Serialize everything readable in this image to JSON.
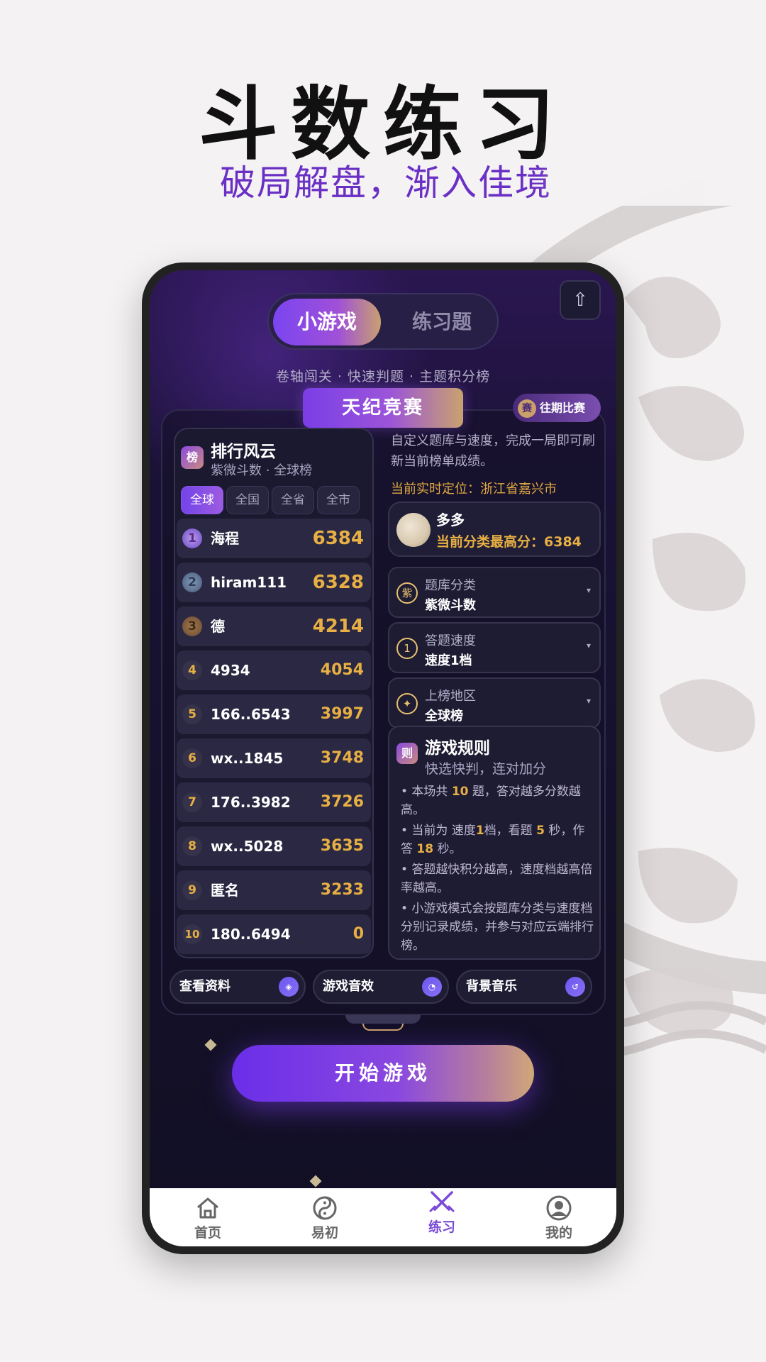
{
  "hero": {
    "title": "斗数练习",
    "subtitle": "破局解盘，渐入佳境"
  },
  "top_tabs": {
    "active": "小游戏",
    "inactive": "练习题"
  },
  "share_icon": "share-icon",
  "features_line": "卷轴闯关 · 快速判题 · 主题积分榜",
  "banner": "天纪竞赛",
  "past_button": {
    "badge": "赛",
    "label": "往期比赛"
  },
  "leaderboard": {
    "icon": "榜",
    "title": "排行风云",
    "subtitle": "紫微斗数 · 全球榜",
    "scopes": [
      "全球",
      "全国",
      "全省",
      "全市"
    ],
    "active_scope": "全球",
    "rows": [
      {
        "rank": "1",
        "name": "海程",
        "score": "6384"
      },
      {
        "rank": "2",
        "name": "hiram111",
        "score": "6328"
      },
      {
        "rank": "3",
        "name": "德",
        "score": "4214"
      },
      {
        "rank": "4",
        "name": "4934",
        "score": "4054"
      },
      {
        "rank": "5",
        "name": "166..6543",
        "score": "3997"
      },
      {
        "rank": "6",
        "name": "wx..1845",
        "score": "3748"
      },
      {
        "rank": "7",
        "name": "176..3982",
        "score": "3726"
      },
      {
        "rank": "8",
        "name": "wx..5028",
        "score": "3635"
      },
      {
        "rank": "9",
        "name": "匿名",
        "score": "3233"
      },
      {
        "rank": "10",
        "name": "180..6494",
        "score": "0"
      }
    ]
  },
  "info": {
    "description": "自定义题库与速度，完成一局即可刷新当前榜单成绩。",
    "location": "当前实时定位：浙江省嘉兴市"
  },
  "user": {
    "name": "多多",
    "best": "当前分类最高分：6384"
  },
  "selects": [
    {
      "icon": "紫",
      "label": "题库分类",
      "value": "紫微斗数"
    },
    {
      "icon": "1",
      "label": "答题速度",
      "value": "速度1档"
    },
    {
      "icon": "✦",
      "label": "上榜地区",
      "value": "全球榜"
    }
  ],
  "rules": {
    "icon": "则",
    "title": "游戏规则",
    "subtitle": "快选快判，连对加分",
    "r1a": "• 本场共 ",
    "r1n": "10",
    "r1b": " 题，答对越多分数越高。",
    "r2a": "• 当前为 速度",
    "r2n": "1",
    "r2b": "档，看题 ",
    "r2n2": "5",
    "r2c": " 秒，作答 ",
    "r2n3": "18",
    "r2d": " 秒。",
    "r3": "• 答题越快积分越高，速度档越高倍率越高。",
    "r4": "• 小游戏模式会按题库分类与速度档分别记录成绩，并参与对应云端排行榜。"
  },
  "toggles": [
    {
      "label": "查看资料",
      "icon": "◈"
    },
    {
      "label": "游戏音效",
      "icon": "◔"
    },
    {
      "label": "背景音乐",
      "icon": "↺"
    }
  ],
  "start_button": "开始游戏",
  "nav": [
    {
      "label": "首页",
      "icon": "home-icon"
    },
    {
      "label": "易初",
      "icon": "yin-yang-icon"
    },
    {
      "label": "练习",
      "icon": "crossed-swords-icon",
      "active": true
    },
    {
      "label": "我的",
      "icon": "user-icon"
    }
  ],
  "colors": {
    "accent": "#7a45f0",
    "gold": "#e8b044",
    "hero_sub": "#6a2fc4"
  }
}
